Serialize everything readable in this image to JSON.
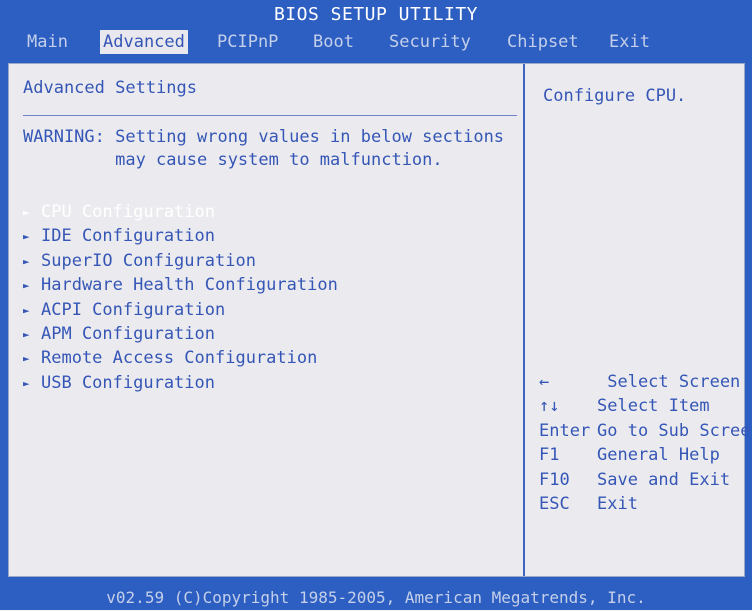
{
  "title": "BIOS SETUP UTILITY",
  "menu": [
    "Main",
    "Advanced",
    "PCIPnP",
    "Boot",
    "Security",
    "Chipset",
    "Exit"
  ],
  "active_menu": "Advanced",
  "left": {
    "section_title": "Advanced Settings",
    "warning_line1": "WARNING: Setting wrong values in below sections",
    "warning_line2": "         may cause system to malfunction.",
    "items": [
      "CPU Configuration",
      "IDE Configuration",
      "SuperIO Configuration",
      "Hardware Health Configuration",
      "ACPI Configuration",
      "APM Configuration",
      "Remote Access Configuration",
      "USB Configuration"
    ],
    "selected_item": "CPU Configuration",
    "arrow_glyph": "►"
  },
  "right": {
    "help_text": "Configure CPU.",
    "keys": [
      {
        "key": "←",
        "desc": " Select Screen"
      },
      {
        "key": "↑↓",
        "desc": "Select Item"
      },
      {
        "key": "Enter",
        "desc": "Go to Sub Screen"
      },
      {
        "key": "F1",
        "desc": "General Help"
      },
      {
        "key": "F10",
        "desc": "Save and Exit"
      },
      {
        "key": "ESC",
        "desc": "Exit"
      }
    ]
  },
  "footer": "v02.59 (C)Copyright 1985-2005, American Megatrends, Inc.",
  "colors": {
    "background": "#2d5fc2",
    "panel": "#ebebef",
    "text": "#3556b6",
    "selected": "#ffffff",
    "menu_inactive": "#c4cfe9"
  }
}
